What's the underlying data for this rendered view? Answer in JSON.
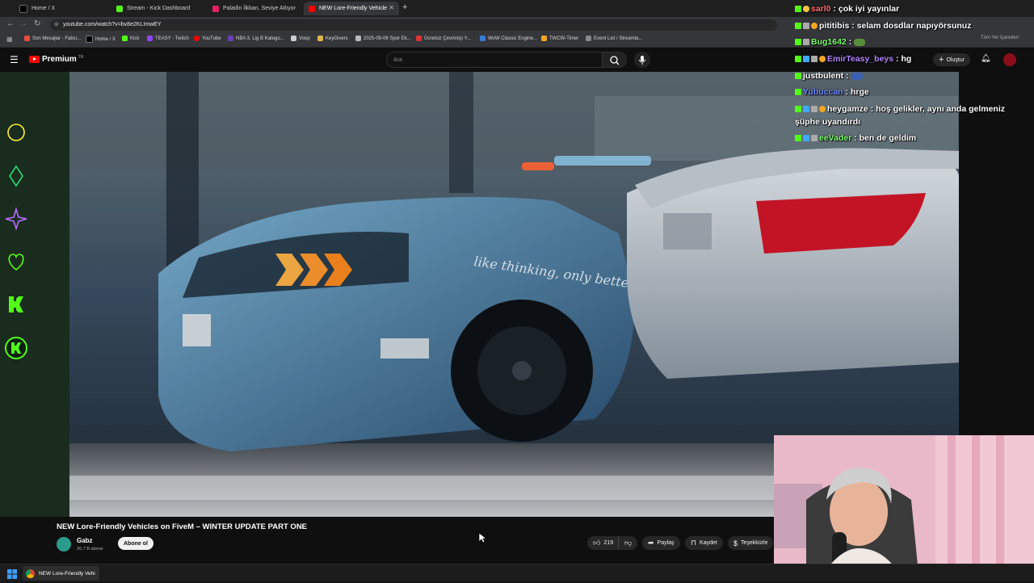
{
  "browser": {
    "tabs": [
      {
        "label": "Home / X",
        "color": "#111111"
      },
      {
        "label": "Stream - Kick Dashboard",
        "color": "#53fc18"
      },
      {
        "label": "Paladin İlkkan, Seviye Atlıyor",
        "color": "#e91e63"
      },
      {
        "label": "NEW Lore-Friendly Vehicle",
        "color": "#ff0000"
      }
    ],
    "url": "youtube.com/watch?v=bv8e2KLImwEY",
    "bookmarks": [
      "Son Mesajlar - Fabci...",
      "Home / X",
      "Kick",
      "TEASY - Twitch",
      "YouTube",
      "NBA 3. Lig B Katego...",
      "Voop",
      "KeyGivers",
      "2025-09-06 Spor Ek...",
      "Ücretsiz Çevrimiçi Y...",
      "WoW Classic Engine...",
      "TWCW-Timer",
      "Event List / Streamla..."
    ],
    "bookmarks_right": "Tüm Yer İşaretleri"
  },
  "youtube": {
    "logo": "Premium",
    "logo_suffix": "TR",
    "search_placeholder": "Ara",
    "create_label": "Oluştur"
  },
  "video": {
    "title": "NEW Lore-Friendly Vehicles on FiveM – WINTER UPDATE PART ONE",
    "channel": "Gabz",
    "subscribers": "26,7 B abone",
    "subscribe_label": "Abone ol",
    "likes": "219",
    "share_label": "Paylaş",
    "save_label": "Kaydet",
    "thanks_label": "Teşekkürle",
    "car_text": "like thinking, only better"
  },
  "chat": [
    {
      "user": "sarl0",
      "text": "çok iyi yayınlar",
      "color": "#ff6b6b"
    },
    {
      "user": "pititibis",
      "text": "selam dosdlar napıyörsunuz",
      "color": "#ffffff"
    },
    {
      "user": "Bug1642",
      "text": "",
      "color": "#7cff6b"
    },
    {
      "user": "EmirTeasy_beys",
      "text": "hg",
      "color": "#b184ff"
    },
    {
      "user": "justbulent",
      "text": "",
      "color": "#ffffff"
    },
    {
      "user": "Yubuccan",
      "text": "hrge",
      "color": "#6d8cff"
    },
    {
      "user": "heygamze",
      "text": "hoş gelikler, aynı anda gelmeniz",
      "color": "#ffffff"
    },
    {
      "user": "",
      "text": "şüphe uyandırdı",
      "color": "#ffffff"
    },
    {
      "user": "eeVader",
      "text": "ben de geldim",
      "color": "#7cff6b"
    }
  ],
  "taskbar": {
    "window_label": "NEW Lore-Friendly Vehi"
  },
  "colors": {
    "kick_green": "#53fc18",
    "yt_red": "#ff0000"
  }
}
